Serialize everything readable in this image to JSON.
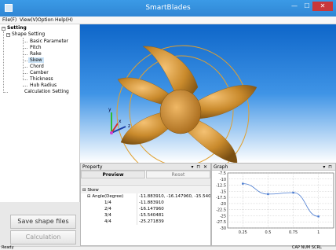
{
  "window": {
    "title": "SmartBlades"
  },
  "menu": [
    "File(F)",
    "View(V)",
    "Option",
    "Help(H)"
  ],
  "tree": {
    "root": "Setting",
    "group": "Shape Setting",
    "items": [
      "Basic Parameter",
      "Pitch",
      "Rake",
      "Skew",
      "Chord",
      "Camber",
      "Thickness",
      "Hub Radius"
    ],
    "selected": "Skew",
    "calc": "Calculation Setting"
  },
  "left_buttons": {
    "save": "Save shape files",
    "calculation": "Calculation"
  },
  "viewport": {
    "axis_labels": {
      "y": "y",
      "x": "x",
      "z": "z"
    },
    "blade_color": "#c98a2c",
    "ring_color": "#e0a030"
  },
  "property": {
    "title": "Property",
    "panel_controls": "▾ ⊓ ✕",
    "preview_label": "Preview",
    "reset_label": "Reset",
    "group": "Skew",
    "param": {
      "name": "Angle(Degree)",
      "value": "-11.883910, -16.147960, -15.54048..."
    },
    "rows": [
      {
        "name": "1/4",
        "value": "-11.883910"
      },
      {
        "name": "2/4",
        "value": "-16.147960"
      },
      {
        "name": "3/4",
        "value": "-15.540481"
      },
      {
        "name": "4/4",
        "value": "-25.271839"
      }
    ]
  },
  "graph": {
    "title": "Graph",
    "panel_controls": "▾ ⊓",
    "chart_data": {
      "type": "line",
      "x": [
        0.25,
        0.5,
        0.75,
        1
      ],
      "values": [
        -11.88391,
        -16.14796,
        -15.540481,
        -25.271839
      ],
      "xticks": [
        "0.25",
        "0.5",
        "0.75",
        "1"
      ],
      "yticks": [
        "-7.5",
        "-10",
        "-12.5",
        "-15",
        "-17.5",
        "-20",
        "-22.5",
        "-25",
        "-27.5",
        "-30"
      ],
      "ylim": [
        -30,
        -7.5
      ],
      "xlim": [
        0.1,
        1.15
      ],
      "grid": true,
      "line_color": "#4a7bd0"
    }
  },
  "status": {
    "left": "Ready",
    "right": "CAP  NUM  SCRL"
  }
}
